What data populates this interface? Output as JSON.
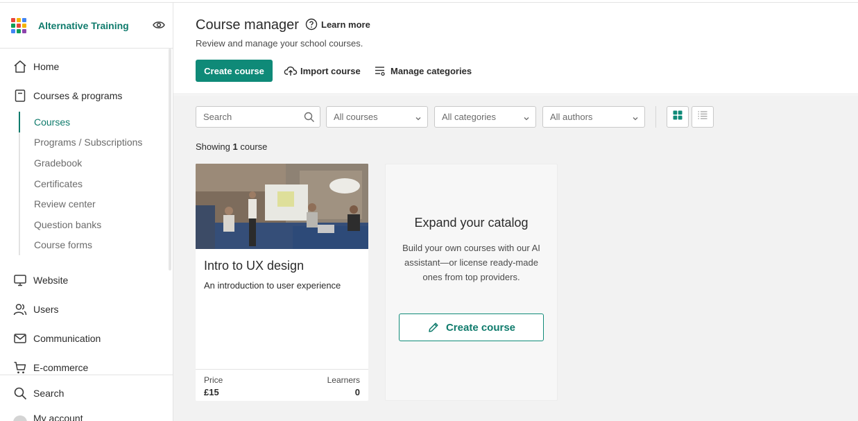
{
  "brand": {
    "name": "Alternative Training",
    "logo_colors": [
      "#e8453c",
      "#f4b400",
      "#4285f4",
      "#0f9d58",
      "#e8453c",
      "#f4b400",
      "#4285f4",
      "#0f9d58",
      "#8e44ad"
    ]
  },
  "sidebar": {
    "main_items": [
      {
        "label": "Home",
        "icon": "home-icon"
      },
      {
        "label": "Courses & programs",
        "icon": "book-icon"
      }
    ],
    "sub_items": [
      {
        "label": "Courses",
        "active": true
      },
      {
        "label": "Programs / Subscriptions"
      },
      {
        "label": "Gradebook"
      },
      {
        "label": "Certificates"
      },
      {
        "label": "Review center"
      },
      {
        "label": "Question banks"
      },
      {
        "label": "Course forms"
      }
    ],
    "more_items": [
      {
        "label": "Website",
        "icon": "monitor-icon"
      },
      {
        "label": "Users",
        "icon": "users-icon"
      },
      {
        "label": "Communication",
        "icon": "mail-icon"
      },
      {
        "label": "E-commerce",
        "icon": "cart-icon"
      }
    ],
    "bottom_items": [
      {
        "label": "Search",
        "icon": "search-icon"
      },
      {
        "label": "My account",
        "icon": "avatar"
      }
    ]
  },
  "header": {
    "title": "Course manager",
    "learn_more": "Learn more",
    "subtitle": "Review and manage your school courses.",
    "create_course": "Create course",
    "import_course": "Import course",
    "manage_categories": "Manage categories"
  },
  "filters": {
    "search_placeholder": "Search",
    "courses_select": "All courses",
    "categories_select": "All categories",
    "authors_select": "All authors"
  },
  "results": {
    "showing_prefix": "Showing",
    "count": "1",
    "suffix": "course"
  },
  "course": {
    "title": "Intro to UX design",
    "description": "An introduction to user experience",
    "price_label": "Price",
    "price_value": "£15",
    "learners_label": "Learners",
    "learners_value": "0"
  },
  "expand": {
    "title": "Expand your catalog",
    "text": "Build your own courses with our AI assistant—or license ready-made ones from top providers.",
    "button": "Create course"
  },
  "colors": {
    "accent": "#0f8a78",
    "accent_text": "#0f7b6c"
  }
}
